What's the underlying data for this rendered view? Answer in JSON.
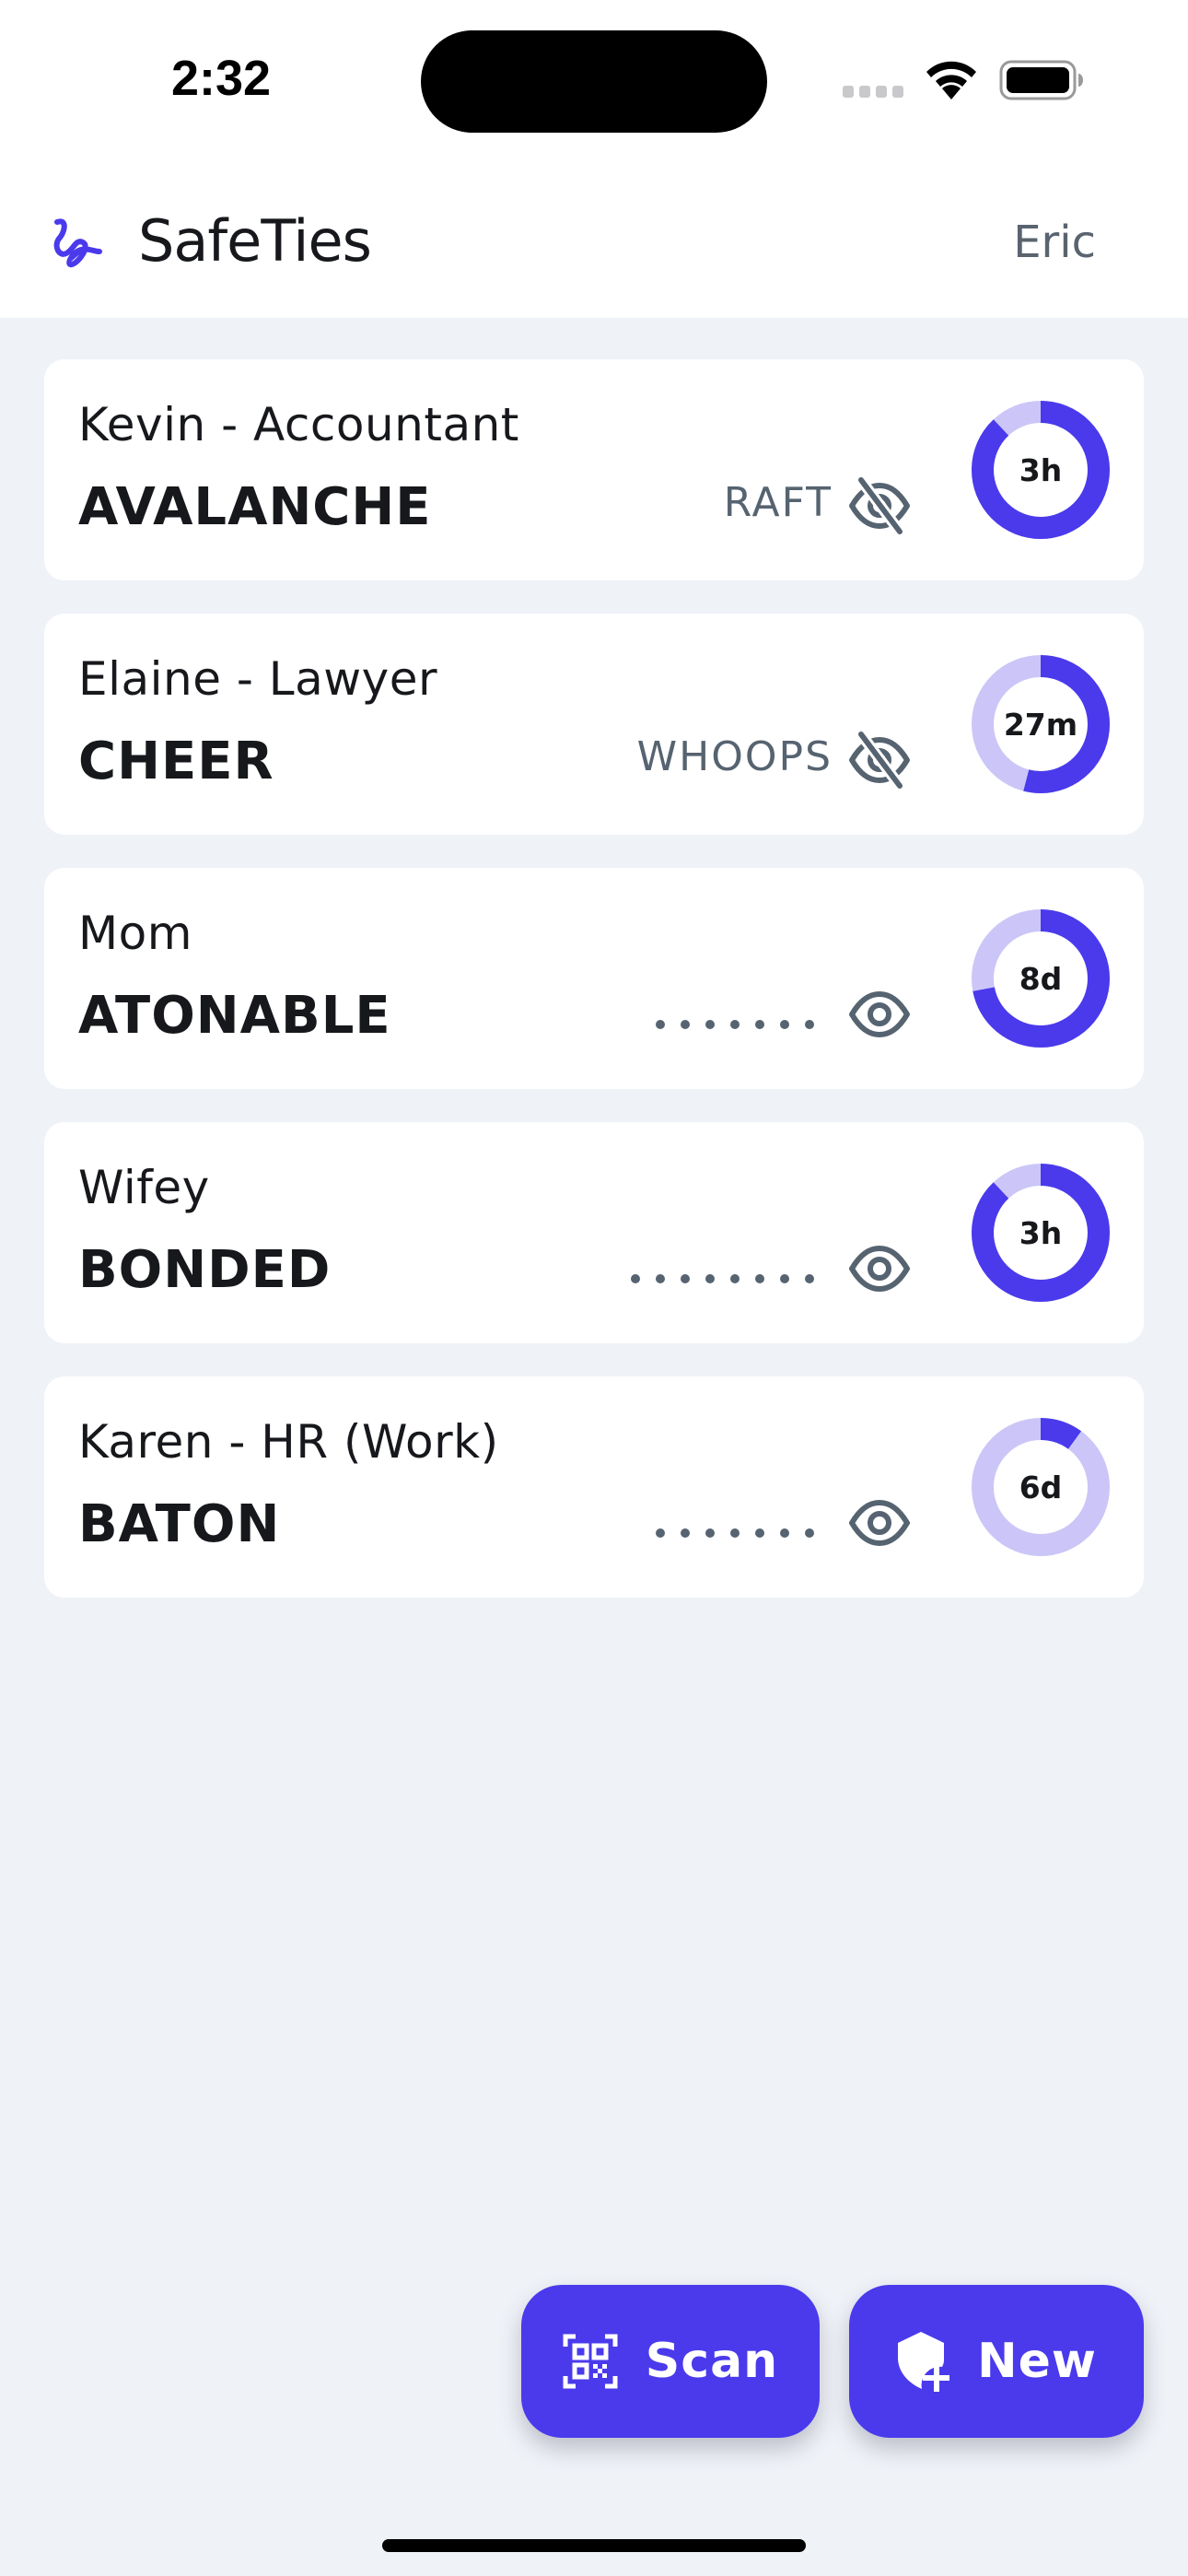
{
  "status_bar": {
    "time": "2:32"
  },
  "header": {
    "app_title": "SafeTies",
    "user_name": "Eric",
    "logo_icon": "squiggle-logo-icon"
  },
  "colors": {
    "accent": "#4a3aec",
    "accent_light": "#cbc6f7",
    "background": "#eff2f7",
    "card": "#ffffff",
    "muted_text": "#566370"
  },
  "ties": [
    {
      "name": "Kevin - Accountant",
      "word": "AVALANCHE",
      "secret": "RAFT",
      "secret_visible": true,
      "mask_dots": 0,
      "visibility_icon": "eye-off-icon",
      "timer_label": "3h",
      "timer_fraction": 0.88
    },
    {
      "name": "Elaine - Lawyer",
      "word": "CHEER",
      "secret": "WHOOPS",
      "secret_visible": true,
      "mask_dots": 0,
      "visibility_icon": "eye-off-icon",
      "timer_label": "27m",
      "timer_fraction": 0.54
    },
    {
      "name": "Mom",
      "word": "ATONABLE",
      "secret": "",
      "secret_visible": false,
      "mask_dots": 7,
      "visibility_icon": "eye-icon",
      "timer_label": "8d",
      "timer_fraction": 0.72
    },
    {
      "name": "Wifey",
      "word": "BONDED",
      "secret": "",
      "secret_visible": false,
      "mask_dots": 8,
      "visibility_icon": "eye-icon",
      "timer_label": "3h",
      "timer_fraction": 0.88
    },
    {
      "name": "Karen - HR (Work)",
      "word": "BATON",
      "secret": "",
      "secret_visible": false,
      "mask_dots": 7,
      "visibility_icon": "eye-icon",
      "timer_label": "6d",
      "timer_fraction": 0.1
    }
  ],
  "actions": {
    "scan_label": "Scan",
    "scan_icon": "qr-scan-icon",
    "new_label": "New",
    "new_icon": "shield-plus-icon"
  }
}
